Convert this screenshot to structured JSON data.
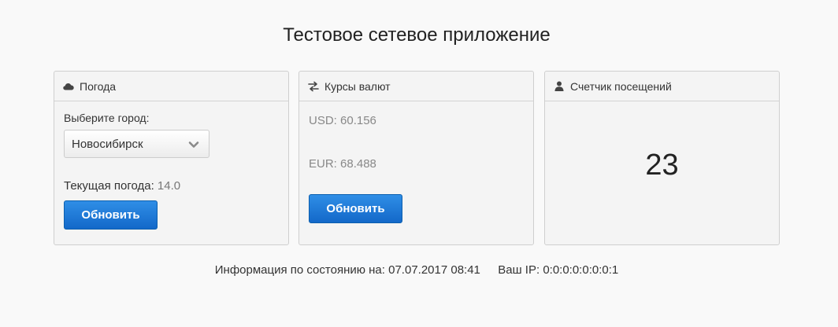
{
  "page": {
    "title": "Тестовое сетевое приложение"
  },
  "weather": {
    "heading": "Погода",
    "icon": "cloud-icon",
    "city_label": "Выберите город:",
    "city_selected": "Новосибирск",
    "current_label": "Текущая погода:",
    "current_value": "14.0",
    "update_button": "Обновить"
  },
  "currency": {
    "heading": "Курсы валют",
    "icon": "exchange-icon",
    "usd": "USD: 60.156",
    "eur": "EUR: 68.488",
    "update_button": "Обновить"
  },
  "counter": {
    "heading": "Счетчик посещений",
    "icon": "user-icon",
    "value": "23"
  },
  "footer": {
    "status_label": "Информация по состоянию на:",
    "status_datetime": "07.07.2017 08:41",
    "ip_label": "Ваш IP:",
    "ip_value": "0:0:0:0:0:0:0:1"
  },
  "colors": {
    "background": "#f9f9f9",
    "panel_bg": "#f4f4f4",
    "panel_border": "#cfcfcf",
    "button_primary": "#1a73d6"
  }
}
